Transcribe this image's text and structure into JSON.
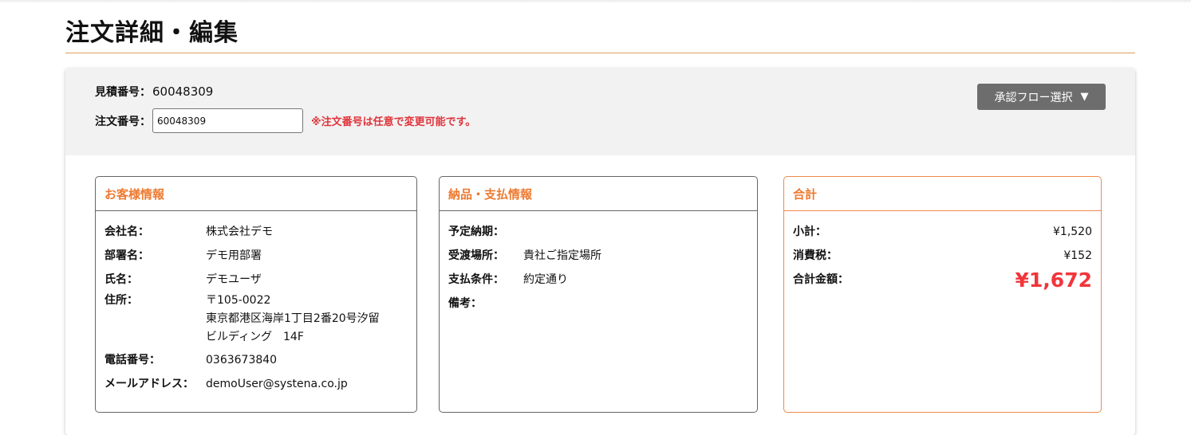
{
  "page": {
    "title": "注文詳細・編集"
  },
  "header": {
    "estimate_label": "見積番号：",
    "estimate_value": "60048309",
    "order_label": "注文番号：",
    "order_value": "60048309",
    "order_note": "※注文番号は任意で変更可能です。",
    "approval_button": "承認フロー選択",
    "approval_icon": "triangle-down-icon"
  },
  "customer": {
    "title": "お客様情報",
    "rows": [
      {
        "label": "会社名：",
        "value": "株式会社デモ"
      },
      {
        "label": "部署名：",
        "value": "デモ用部署"
      },
      {
        "label": "氏名：",
        "value": "デモユーザ"
      },
      {
        "label": "住所：",
        "value": "〒105-0022\n東京都港区海岸1丁目2番20号汐留\nビルディング　14F"
      },
      {
        "label": "電話番号：",
        "value": "0363673840"
      },
      {
        "label": "メールアドレス：",
        "value": "demoUser@systena.co.jp"
      }
    ]
  },
  "delivery": {
    "title": "納品・支払情報",
    "rows": [
      {
        "label": "予定納期：",
        "value": ""
      },
      {
        "label": "受渡場所：",
        "value": "貴社ご指定場所"
      },
      {
        "label": "支払条件：",
        "value": "約定通り"
      },
      {
        "label": "備考：",
        "value": ""
      }
    ]
  },
  "totals": {
    "title": "合計",
    "subtotal_label": "小計：",
    "subtotal_value": "¥1,520",
    "tax_label": "消費税：",
    "tax_value": "¥152",
    "total_label": "合計金額：",
    "total_value": "¥1,672"
  },
  "colors": {
    "accent_orange": "#ee7a30",
    "rule": "#d9a057",
    "alert_red": "#e0343c",
    "total_red": "#f2353b",
    "button_gray": "#6d6d6d"
  }
}
